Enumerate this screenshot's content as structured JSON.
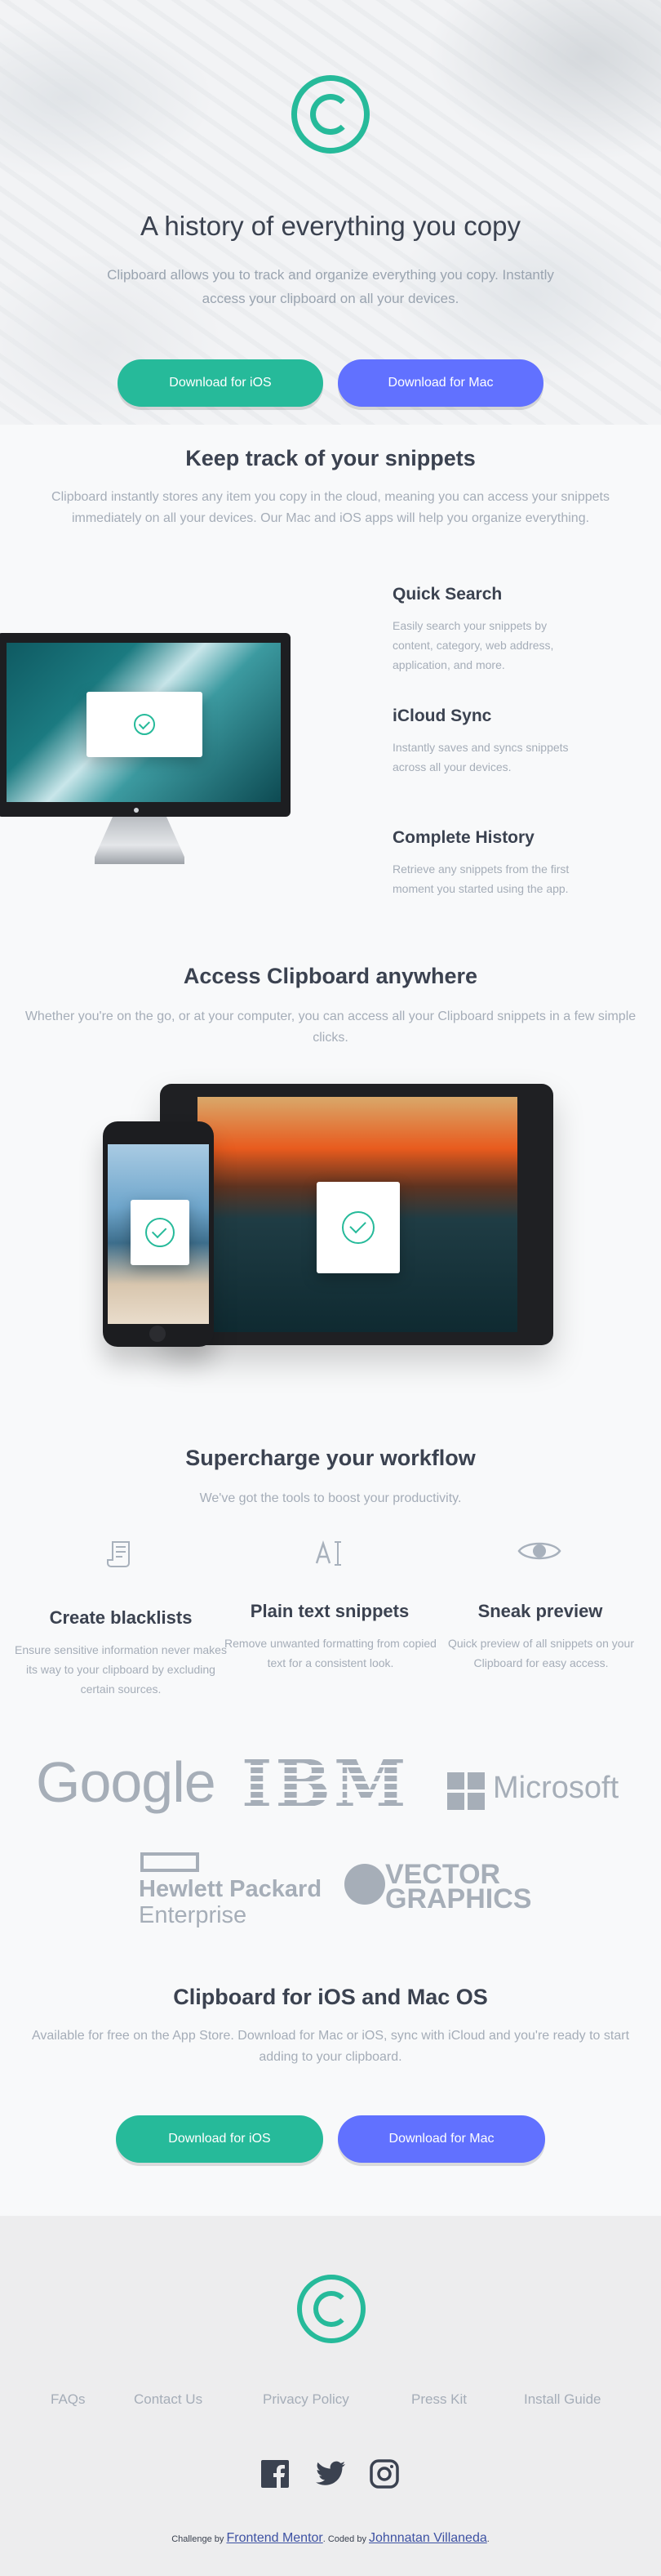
{
  "hero": {
    "title": "A history of everything you copy",
    "description": "Clipboard allows you to track and organize everything you copy. Instantly access your clipboard on all your devices.",
    "ios_button": "Download for iOS",
    "mac_button": "Download for Mac"
  },
  "snippets": {
    "title": "Keep track of your snippets",
    "description": "Clipboard instantly stores any item you copy in the cloud, meaning you can access your snippets immediately on all your devices. Our Mac and iOS apps will help you organize everything.",
    "features": [
      {
        "title": "Quick Search",
        "description": "Easily search your snippets by content, category, web address, application, and more."
      },
      {
        "title": "iCloud Sync",
        "description": "Instantly saves and syncs snippets across all your devices."
      },
      {
        "title": "Complete History",
        "description": "Retrieve any snippets from the first moment you started using the app."
      }
    ]
  },
  "access": {
    "title": "Access Clipboard anywhere",
    "description": "Whether you're on the go, or at your computer, you can access all your Clipboard snippets in a few simple clicks."
  },
  "workflow": {
    "title": "Supercharge your workflow",
    "description": "We've got the tools to boost your productivity.",
    "items": [
      {
        "icon": "blacklist-icon",
        "title": "Create blacklists",
        "description": "Ensure sensitive information never makes its way to your clipboard by excluding certain sources."
      },
      {
        "icon": "text-icon",
        "title": "Plain text snippets",
        "description": "Remove unwanted formatting from copied text for a consistent look."
      },
      {
        "icon": "eye-icon",
        "title": "Sneak preview",
        "description": "Quick preview of all snippets on your Clipboard for easy access."
      }
    ]
  },
  "partners": {
    "google": "Google",
    "ibm": "IBM",
    "microsoft": "Microsoft",
    "hp_line1": "Hewlett Packard",
    "hp_line2": "Enterprise",
    "vector_line1": "VECTOR",
    "vector_line2": "GRAPHICS"
  },
  "cta": {
    "title": "Clipboard for iOS and Mac OS",
    "description": "Available for free on the App Store. Download for Mac or iOS, sync with iCloud and you're ready to start adding to your clipboard.",
    "ios_button": "Download for iOS",
    "mac_button": "Download for Mac"
  },
  "footer": {
    "links": [
      "FAQs",
      "Contact Us",
      "Privacy Policy",
      "Press Kit",
      "Install Guide"
    ],
    "social": [
      "facebook-icon",
      "twitter-icon",
      "instagram-icon"
    ],
    "credit_prefix": "Challenge by",
    "credit_challenge": "Frontend Mentor",
    "credit_mid": ". Coded by",
    "credit_author": "Johnnatan Villaneda",
    "credit_suffix": "."
  },
  "colors": {
    "accent_green": "#26ba9a",
    "accent_blue": "#6171ff",
    "heading": "#3b4250",
    "body_text": "#a5adb8"
  }
}
